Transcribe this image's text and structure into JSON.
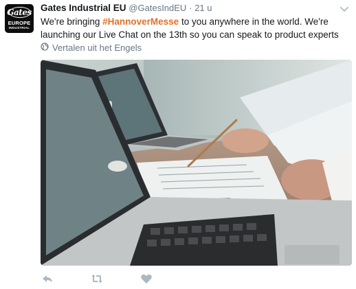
{
  "author": {
    "display_name": "Gates Industrial EU",
    "handle": "@GatesIndEU",
    "separator": "·",
    "time": "21 u",
    "avatar_logo": {
      "script": "Gates",
      "line1": "EUROPE",
      "line2": "INDUSTRIAL"
    }
  },
  "tweet": {
    "text_before": "We're bringing ",
    "hashtag": "#HannoverMesse",
    "text_after": " to you anywhere in the world. We're launching our Live Chat on the 13th so you can speak to product experts",
    "translate_label": "Vertalen uit het Engels"
  },
  "icons": {
    "translate": "globe-icon",
    "menu": "chevron-down-icon",
    "reply": "reply-icon",
    "retweet": "retweet-icon",
    "like": "heart-icon"
  },
  "colors": {
    "hashtag": "#e0702a",
    "text": "#14171a",
    "secondary": "#657786",
    "action_icons": "#aab8c2"
  }
}
